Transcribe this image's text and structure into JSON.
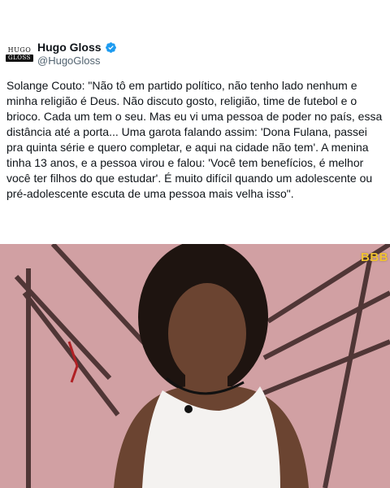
{
  "account": {
    "display_name": "Hugo Gloss",
    "handle": "@HugoGloss",
    "avatar_text_top": "HUGO",
    "avatar_text_bottom": "GLOSS",
    "verified_color": "#1d9bf0"
  },
  "tweet": {
    "text": "Solange Couto: \"Não tô em partido político, não tenho lado nenhum e minha religião é Deus. Não discuto gosto, religião, time de futebol e o brioco. Cada um tem o seu. Mas eu vi uma pessoa de poder no país, essa distância até a porta... Uma garota falando assim: 'Dona Fulana, passei pra quinta série e quero completar, e aqui na cidade não tem'. A menina tinha 13 anos, e a pessoa virou e falou: 'Você tem benefícios, é melhor você ter filhos do que estudar'. É muito difícil quando um adolescente ou pré-adolescente escuta de uma pessoa mais velha isso\"."
  },
  "video": {
    "watermark": "BBB",
    "background_color": "#d4a4a7"
  }
}
